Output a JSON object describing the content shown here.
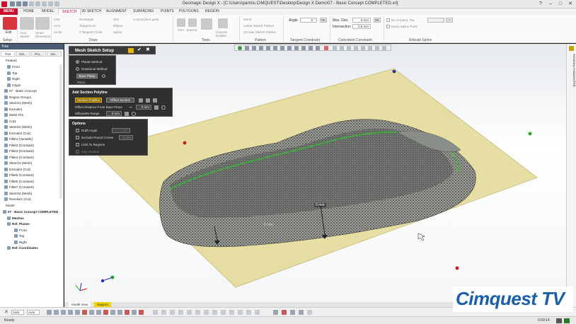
{
  "titlebar": {
    "title": "Geomagic Design X - [C:\\Users\\parmis.CIMQUEST\\Desktop\\Design X Demo\\07 - Basic Concept COMPLETED.xrl]"
  },
  "tabs": [
    {
      "label": "MENU"
    },
    {
      "label": "HOME"
    },
    {
      "label": "MODEL"
    },
    {
      "label": "SKETCH"
    },
    {
      "label": "3D SKETCH"
    },
    {
      "label": "ALIGNMENT"
    },
    {
      "label": "SURFACING"
    },
    {
      "label": "POINTS"
    },
    {
      "label": "POLYGONS"
    },
    {
      "label": "REGION"
    }
  ],
  "ribbon": {
    "groups": {
      "setup": "Setup",
      "draw": "Draw",
      "tools": "Tools",
      "pattern": "Pattern",
      "tangent": "Tangent Constraint",
      "coincident": "Coincident Constraint",
      "rebuild": "Rebuild Spline"
    },
    "exit": "Exit",
    "auto_sketch": "Auto Sketch",
    "smart_dimension": "Smart Dimension",
    "draw_items": [
      "Line",
      "Arcs",
      "Circle",
      "Rectangle",
      "Tangent Arc",
      "3 Tangent Circle",
      "Slot",
      "Ellipse",
      "Spline",
      "Construction point"
    ],
    "tools_items": [
      "Trim",
      "Extend",
      "Offset",
      "Convert Entities"
    ],
    "pattern_items": [
      "Mirror",
      "Linear Sketch Pattern",
      "Circular Sketch Pattern"
    ],
    "angle_label": "Angle",
    "angle_value": "5 °",
    "ok": "OK",
    "max_dist_label": "Max. Dist.",
    "max_dist_value": "5 mm",
    "intersection_label": "Intersection",
    "intersection_value": "2.5 mm",
    "interp_label": "No.of interp. Pts.",
    "every_spline": "Every Spline Point"
  },
  "left_panel": {
    "header": "Tree",
    "tabs": [
      "Tree",
      "Dis...",
      "Pro...",
      "Vie..."
    ],
    "feature_header": "Feature",
    "feature_items": [
      "Front",
      "Top",
      "Right",
      "Origin",
      "07 - Basic Concept",
      "Region Group1",
      "Sketch1 (Mesh)",
      "Extrude1",
      "Mesh Fit1",
      "Cut1",
      "Sketch2 (Mesh)",
      "Extrude2 (Cut)",
      "Fillet1 (Variable)",
      "Fillet2 (Constant)",
      "Fillet3 (Constant)",
      "Fillet4 (Constant)",
      "Sketch3 (Mesh)",
      "Extrude3 (Cut)",
      "Fillet5 (Constant)",
      "Fillet6 (Constant)",
      "Fillet7 (Constant)",
      "Sketch4 (Mesh)",
      "Revolve1 (Cut)"
    ],
    "model_header": "Model",
    "model_items": [
      "07 - Basic Concept COMPLETED",
      "Meshes",
      "Ref. Planes",
      "Front",
      "Top",
      "Right",
      "Ref. Coordinates"
    ]
  },
  "dialog": {
    "title": "Mesh Sketch Setup",
    "planar": "Planar Method",
    "rotational": "Rotational Method",
    "base_plane": "Base Plane",
    "plane_value": "Plane",
    "section_header": "Add Section Polyline",
    "section_polyline": "Section Polyline",
    "offset_section": "Offset Section",
    "offset_distance_label": "Offset Distance From Base Plane",
    "offset_distance_value": "0 mm",
    "silhouette_label": "Silhouette Range",
    "silhouette_value": "0 mm",
    "options_header": "Options",
    "draft_angle": "Draft Angle",
    "draft_value": "0 °",
    "exclude_round": "Exclude Round Corner",
    "round_value": "0 mm",
    "limit_regions": "Limit To Regions",
    "avg_section": "Avg. Section"
  },
  "viewport": {
    "dimension_label": "0 mm",
    "dimension_label2": "0 mm"
  },
  "right_strip": {
    "label": "Accuracy Analyzer(TM)"
  },
  "bottom_tabs": [
    "Model View",
    "Support"
  ],
  "bottom_tool": {
    "mode": "Auto",
    "select": "Auto"
  },
  "status": {
    "text": "Ready",
    "time": "0:00:14"
  },
  "logo": {
    "text": "Cimquest TV"
  },
  "colors": {
    "accent": "#c8102e",
    "cloud": "#3a3f3a",
    "plane": "#e5db9a",
    "logo": "#1a5fa8"
  }
}
